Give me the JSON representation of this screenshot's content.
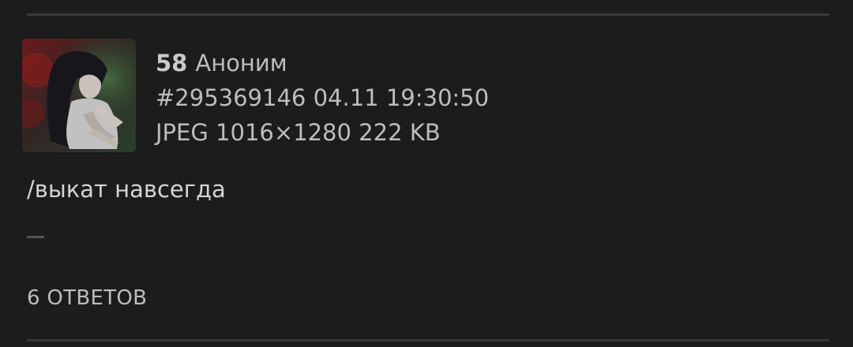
{
  "post": {
    "index": "58",
    "author": "Аноним",
    "post_id": "#295369146",
    "datetime": "04.11 19:30:50",
    "file_info": "JPEG 1016×1280 222 KB",
    "text": "/выкат навсегда",
    "replies_label": "6 ОТВЕТОВ"
  },
  "colors": {
    "background": "#1c1c1c",
    "divider": "#3a3a3a",
    "text": "#bdbdbd"
  }
}
